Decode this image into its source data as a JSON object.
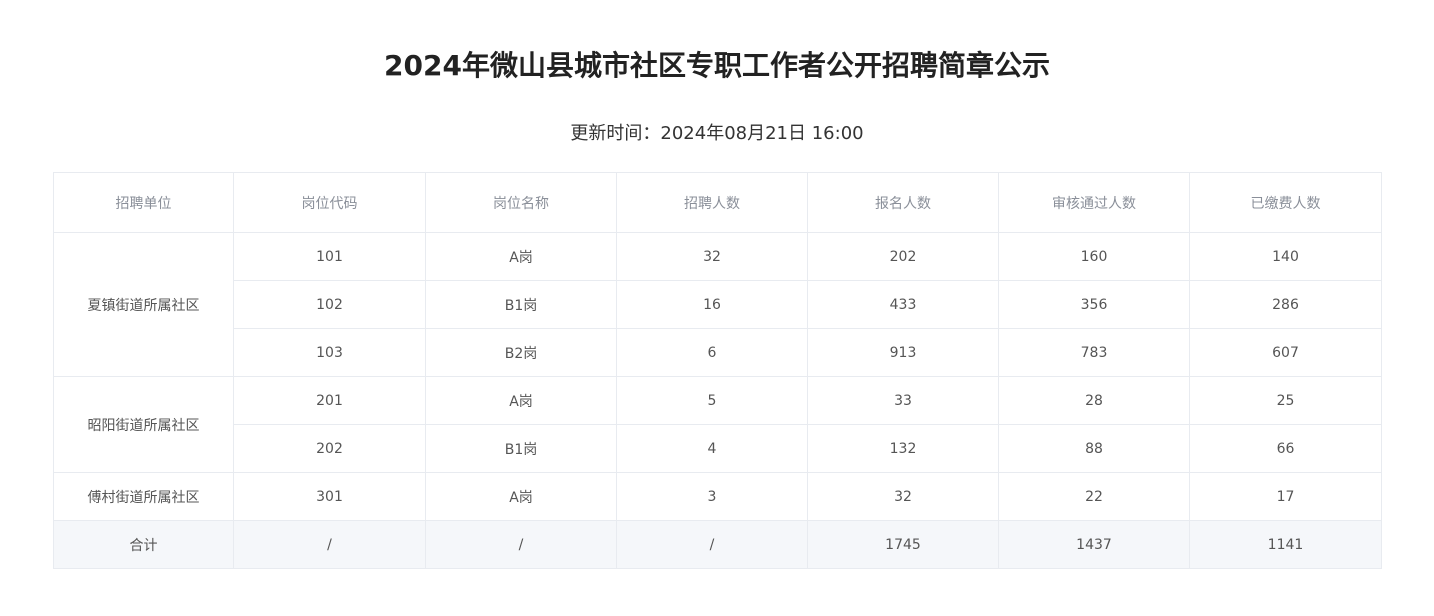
{
  "page": {
    "title": "2024年微山县城市社区专职工作者公开招聘简章公示",
    "update_label": "更新时间：",
    "update_time": "2024年08月21日 16:00"
  },
  "table": {
    "headers": [
      "招聘单位",
      "岗位代码",
      "岗位名称",
      "招聘人数",
      "报名人数",
      "审核通过人数",
      "已缴费人数"
    ],
    "groups": [
      {
        "unit": "夏镇街道所属社区",
        "rows": [
          {
            "code": "101",
            "name": "A岗",
            "quota": "32",
            "applied": "202",
            "approved": "160",
            "paid": "140"
          },
          {
            "code": "102",
            "name": "B1岗",
            "quota": "16",
            "applied": "433",
            "approved": "356",
            "paid": "286"
          },
          {
            "code": "103",
            "name": "B2岗",
            "quota": "6",
            "applied": "913",
            "approved": "783",
            "paid": "607"
          }
        ]
      },
      {
        "unit": "昭阳街道所属社区",
        "rows": [
          {
            "code": "201",
            "name": "A岗",
            "quota": "5",
            "applied": "33",
            "approved": "28",
            "paid": "25"
          },
          {
            "code": "202",
            "name": "B1岗",
            "quota": "4",
            "applied": "132",
            "approved": "88",
            "paid": "66"
          }
        ]
      },
      {
        "unit": "傅村街道所属社区",
        "rows": [
          {
            "code": "301",
            "name": "A岗",
            "quota": "3",
            "applied": "32",
            "approved": "22",
            "paid": "17"
          }
        ]
      }
    ],
    "total": {
      "label": "合计",
      "code": "/",
      "name": "/",
      "quota": "/",
      "applied": "1745",
      "approved": "1437",
      "paid": "1141"
    }
  }
}
